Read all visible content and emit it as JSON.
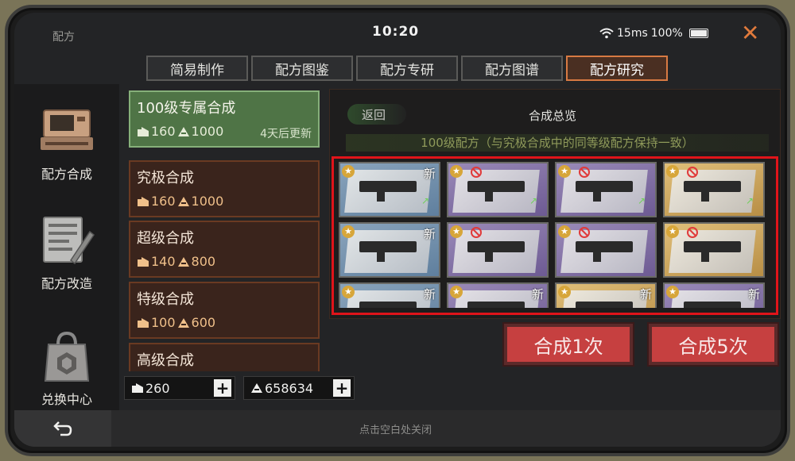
{
  "status": {
    "app_title": "配方",
    "time": "10:20",
    "latency": "15ms",
    "battery": "100%"
  },
  "tabs": [
    {
      "label": "简易制作",
      "active": false
    },
    {
      "label": "配方图鉴",
      "active": false
    },
    {
      "label": "配方专研",
      "active": false
    },
    {
      "label": "配方图谱",
      "active": false
    },
    {
      "label": "配方研究",
      "active": true
    }
  ],
  "sidebar": [
    {
      "label": "配方合成",
      "icon": "crafting-machine-icon"
    },
    {
      "label": "配方改造",
      "icon": "blueprint-edit-icon"
    },
    {
      "label": "兑换中心",
      "icon": "exchange-bag-icon"
    }
  ],
  "recipes": [
    {
      "name": "100级专属合成",
      "cost_a": "160",
      "cost_b": "1000",
      "note": "4天后更新",
      "active": true
    },
    {
      "name": "究极合成",
      "cost_a": "160",
      "cost_b": "1000",
      "note": "",
      "active": false
    },
    {
      "name": "超级合成",
      "cost_a": "140",
      "cost_b": "800",
      "note": "",
      "active": false
    },
    {
      "name": "特级合成",
      "cost_a": "100",
      "cost_b": "600",
      "note": "",
      "active": false
    },
    {
      "name": "高级合成",
      "cost_a": "",
      "cost_b": "",
      "note": "",
      "active": false
    }
  ],
  "currency": {
    "blueprint": "260",
    "material": "658634"
  },
  "main": {
    "back_label": "返回",
    "overview_label": "合成总览",
    "subtitle": "100级配方（与究极合成中的同等级配方保持一致）",
    "cards": [
      {
        "rarity": "blue",
        "new": "新",
        "banned": false,
        "arrow": true
      },
      {
        "rarity": "purple",
        "new": "",
        "banned": true,
        "arrow": true
      },
      {
        "rarity": "purple",
        "new": "",
        "banned": true,
        "arrow": true
      },
      {
        "rarity": "gold",
        "new": "",
        "banned": true,
        "arrow": true
      },
      {
        "rarity": "blue",
        "new": "新",
        "banned": false,
        "arrow": false
      },
      {
        "rarity": "purple",
        "new": "",
        "banned": true,
        "arrow": false
      },
      {
        "rarity": "purple",
        "new": "",
        "banned": true,
        "arrow": false
      },
      {
        "rarity": "gold",
        "new": "",
        "banned": true,
        "arrow": false
      },
      {
        "rarity": "blue",
        "new": "新",
        "banned": false,
        "arrow": false
      },
      {
        "rarity": "purple",
        "new": "新",
        "banned": false,
        "arrow": false
      },
      {
        "rarity": "gold",
        "new": "新",
        "banned": false,
        "arrow": false
      },
      {
        "rarity": "purple",
        "new": "新",
        "banned": false,
        "arrow": false
      }
    ],
    "craft_once": "合成1次",
    "craft_five": "合成5次"
  },
  "bottom": {
    "hint": "点击空白处关闭"
  },
  "colors": {
    "accent": "#d87a43",
    "highlight_frame": "#e0141a",
    "craft_button": "#c64040",
    "active_recipe": "#4f7446"
  }
}
